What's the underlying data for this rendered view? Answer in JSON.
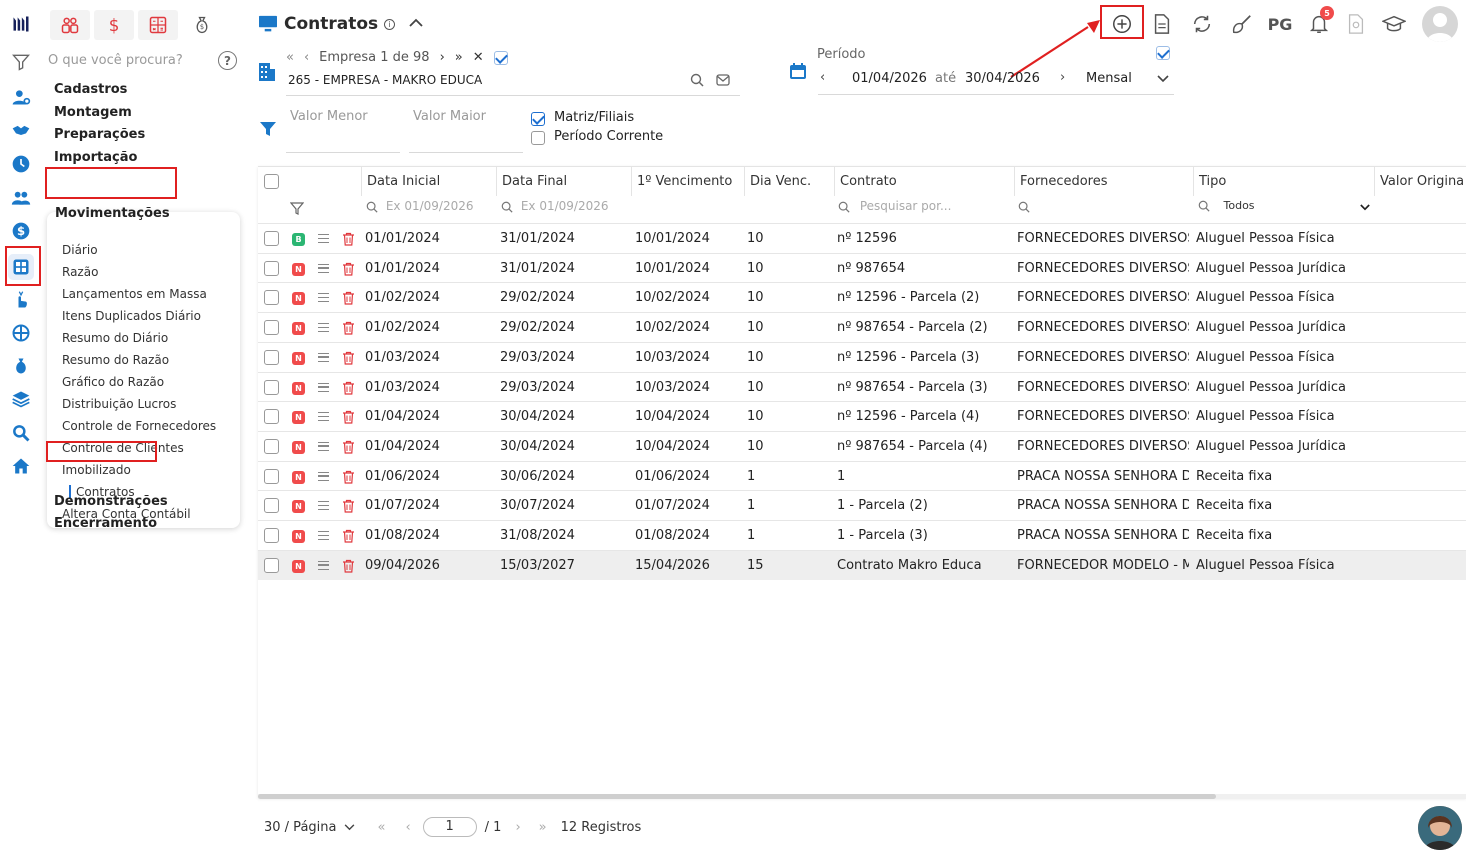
{
  "top_tools": {
    "logo": "logo-mark",
    "items": [
      "people-icon",
      "dollar-icon",
      "calculator-icon",
      "money-bag-icon"
    ]
  },
  "rail_icons": [
    "filter-icon",
    "user-gear-icon",
    "handshake-icon",
    "clock-icon",
    "users-icon",
    "dollar-circle-icon",
    "accounting-icon",
    "hand-cursor-icon",
    "network-icon",
    "money-bag-icon",
    "layers-icon",
    "magnifier-icon",
    "home-icon"
  ],
  "sidebar": {
    "search_placeholder": "O que você procura?",
    "help": "?",
    "sections_top": [
      "Cadastros",
      "Montagem",
      "Preparações",
      "Importação"
    ],
    "active_section": "Movimentações",
    "sub_items": [
      "Diário",
      "Razão",
      "Lançamentos em Massa",
      "Itens Duplicados Diário",
      "Resumo do Diário",
      "Resumo do Razão",
      "Gráfico do Razão",
      "Distribuição Lucros",
      "Controle de Fornecedores",
      "Controle de Clientes",
      "Imobilizado",
      "Contratos",
      "Altera Conta Contábil"
    ],
    "sections_bottom": [
      "Demonstrações",
      "Encerramento"
    ]
  },
  "header": {
    "title": "Contratos",
    "info": "i",
    "right_text": "PG",
    "notification_count": "5"
  },
  "empresa": {
    "nav_label": "Empresa 1 de 98",
    "name": "265 - EMPRESA - MAKRO EDUCA"
  },
  "periodo": {
    "label": "Período",
    "start": "01/04/2026",
    "ate": "até",
    "end": "30/04/2026",
    "mode": "Mensal"
  },
  "filters": {
    "valor_menor": "Valor Menor",
    "valor_maior": "Valor Maior",
    "matriz_filiais": "Matriz/Filiais",
    "periodo_corrente": "Período Corrente"
  },
  "grid": {
    "headers": [
      "Data Inicial",
      "Data Final",
      "1º Vencimento",
      "Dia Venc.",
      "Contrato",
      "Fornecedores",
      "Tipo",
      "Valor Origina"
    ],
    "filter_placeholders": {
      "data_inicial": "Ex 01/09/2026",
      "data_final": "Ex 01/09/2026",
      "contrato": "Pesquisar por...",
      "tipo": "Todos"
    },
    "rows": [
      {
        "status": "B",
        "data_inicial": "01/01/2024",
        "data_final": "31/01/2024",
        "vencimento": "10/01/2024",
        "dia": "10",
        "contrato": "nº 12596",
        "fornecedor": "FORNECEDORES DIVERSOS ...",
        "tipo": "Aluguel Pessoa Física"
      },
      {
        "status": "N",
        "data_inicial": "01/01/2024",
        "data_final": "31/01/2024",
        "vencimento": "10/01/2024",
        "dia": "10",
        "contrato": "nº 987654",
        "fornecedor": "FORNECEDORES DIVERSOS ...",
        "tipo": "Aluguel Pessoa Jurídica"
      },
      {
        "status": "N",
        "data_inicial": "01/02/2024",
        "data_final": "29/02/2024",
        "vencimento": "10/02/2024",
        "dia": "10",
        "contrato": "nº 12596 - Parcela (2)",
        "fornecedor": "FORNECEDORES DIVERSOS ...",
        "tipo": "Aluguel Pessoa Física"
      },
      {
        "status": "N",
        "data_inicial": "01/02/2024",
        "data_final": "29/02/2024",
        "vencimento": "10/02/2024",
        "dia": "10",
        "contrato": "nº 987654 - Parcela (2)",
        "fornecedor": "FORNECEDORES DIVERSOS ...",
        "tipo": "Aluguel Pessoa Jurídica"
      },
      {
        "status": "N",
        "data_inicial": "01/03/2024",
        "data_final": "29/03/2024",
        "vencimento": "10/03/2024",
        "dia": "10",
        "contrato": "nº 12596 - Parcela (3)",
        "fornecedor": "FORNECEDORES DIVERSOS ...",
        "tipo": "Aluguel Pessoa Física"
      },
      {
        "status": "N",
        "data_inicial": "01/03/2024",
        "data_final": "29/03/2024",
        "vencimento": "10/03/2024",
        "dia": "10",
        "contrato": "nº 987654 - Parcela (3)",
        "fornecedor": "FORNECEDORES DIVERSOS ...",
        "tipo": "Aluguel Pessoa Jurídica"
      },
      {
        "status": "N",
        "data_inicial": "01/04/2024",
        "data_final": "30/04/2024",
        "vencimento": "10/04/2024",
        "dia": "10",
        "contrato": "nº 12596 - Parcela (4)",
        "fornecedor": "FORNECEDORES DIVERSOS ...",
        "tipo": "Aluguel Pessoa Física"
      },
      {
        "status": "N",
        "data_inicial": "01/04/2024",
        "data_final": "30/04/2024",
        "vencimento": "10/04/2024",
        "dia": "10",
        "contrato": "nº 987654 - Parcela (4)",
        "fornecedor": "FORNECEDORES DIVERSOS ...",
        "tipo": "Aluguel Pessoa Jurídica"
      },
      {
        "status": "N",
        "data_inicial": "01/06/2024",
        "data_final": "30/06/2024",
        "vencimento": "01/06/2024",
        "dia": "1",
        "contrato": "1",
        "fornecedor": "PRACA NOSSA SENHORA D...",
        "tipo": "Receita fixa"
      },
      {
        "status": "N",
        "data_inicial": "01/07/2024",
        "data_final": "30/07/2024",
        "vencimento": "01/07/2024",
        "dia": "1",
        "contrato": "1 - Parcela (2)",
        "fornecedor": "PRACA NOSSA SENHORA D...",
        "tipo": "Receita fixa"
      },
      {
        "status": "N",
        "data_inicial": "01/08/2024",
        "data_final": "31/08/2024",
        "vencimento": "01/08/2024",
        "dia": "1",
        "contrato": "1 - Parcela (3)",
        "fornecedor": "PRACA NOSSA SENHORA D...",
        "tipo": "Receita fixa"
      },
      {
        "status": "N",
        "data_inicial": "09/04/2026",
        "data_final": "15/03/2027",
        "vencimento": "15/04/2026",
        "dia": "15",
        "contrato": "Contrato Makro Educa",
        "fornecedor": "FORNECEDOR MODELO - M...",
        "tipo": "Aluguel Pessoa Física",
        "selected": true
      }
    ]
  },
  "pager": {
    "per_page": "30 / Página",
    "page": "1",
    "total_pages": "/ 1",
    "records": "12 Registros"
  },
  "colors": {
    "accent": "#1e6fd0",
    "red": "#e02020",
    "status_b": "#2bb673",
    "status_n": "#f04b4b"
  }
}
